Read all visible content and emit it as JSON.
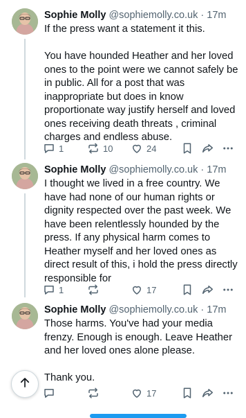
{
  "posts": [
    {
      "name": "Sophie Molly",
      "handle": "@sophiemolly.co.uk",
      "separator": "·",
      "time": "17m",
      "text": "If the press want a statement it this.\n\nYou have hounded Heather and her loved ones to the point were we cannot safely be in public. All for a post that was inappropriate but does in know proportionate way justify herself and loved ones receiving death threats , criminal charges and endless abuse.",
      "replies": "1",
      "reposts": "10",
      "likes": "24"
    },
    {
      "name": "Sophie Molly",
      "handle": "@sophiemolly.co.uk",
      "separator": "·",
      "time": "17m",
      "text": "I thought we lived in a free country. We have had none of our human rights or dignity respected over the past week. We have been relentlessly hounded by the press. If any physical harm comes to Heather myself and her loved ones as direct result of this, i hold the press directly responsible for",
      "replies": "1",
      "reposts": "",
      "likes": "17"
    },
    {
      "name": "Sophie Molly",
      "handle": "@sophiemolly.co.uk",
      "separator": "·",
      "time": "17m",
      "text": "Those harms. You've had your media frenzy. Enough is enough. Leave Heather and her loved ones alone please.\n\nThank you.",
      "replies": "",
      "reposts": "",
      "likes": "17"
    }
  ],
  "icons": {
    "reply": "reply-icon",
    "repost": "repost-icon",
    "like": "heart-icon",
    "bookmark": "bookmark-icon",
    "share": "share-icon",
    "more": "more-icon",
    "scroll_top": "arrow-up-icon"
  },
  "colors": {
    "text": "#0f1419",
    "muted": "#536471",
    "accent": "#1d9bf0",
    "thread_line": "#cfd9de"
  }
}
